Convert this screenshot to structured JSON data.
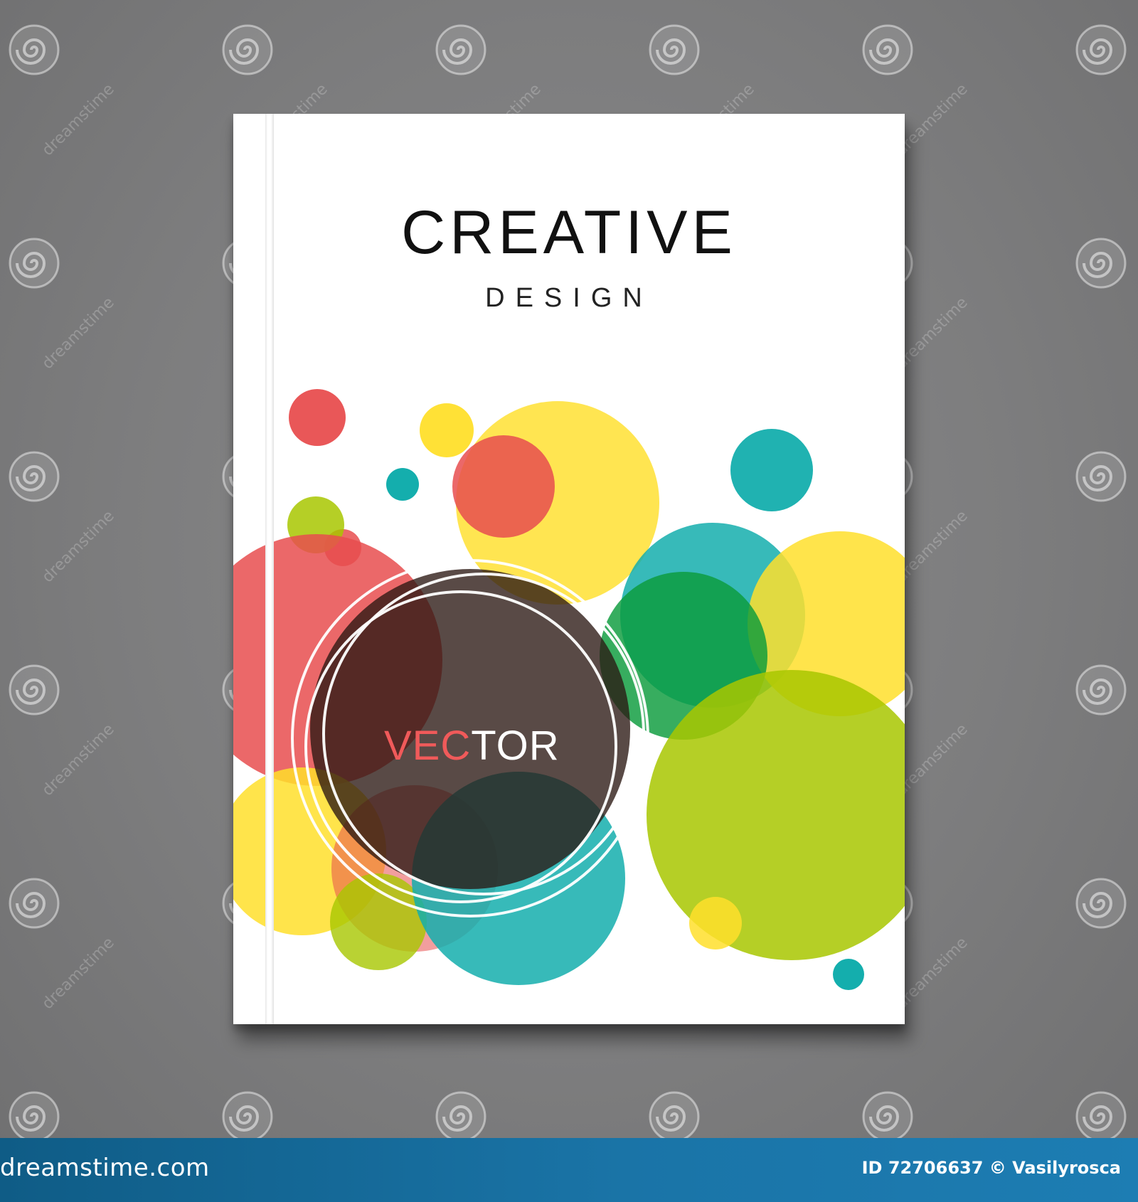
{
  "cover": {
    "title": "CREATIVE",
    "subtitle": "DESIGN",
    "badge_text_highlight": "VEC",
    "badge_text_rest": "TOR"
  },
  "colors": {
    "background": "#7d7d7e",
    "red": "#e84e4f",
    "yellow": "#ffdf2b",
    "teal": "#14aead",
    "green": "#0b9b3c",
    "lime": "#a8c700",
    "dark_badge": "#2a1712",
    "badge_highlight_text": "#f05a5a",
    "badge_rest_text": "#ffffff",
    "footer_bar": "#1a74a7"
  },
  "watermark": {
    "text": "dreamstime",
    "icon": "swirl-logo-icon"
  },
  "footer": {
    "logo_text": "dreamstime.com",
    "id_text": "ID 72706637 © Vasilyrosca"
  }
}
